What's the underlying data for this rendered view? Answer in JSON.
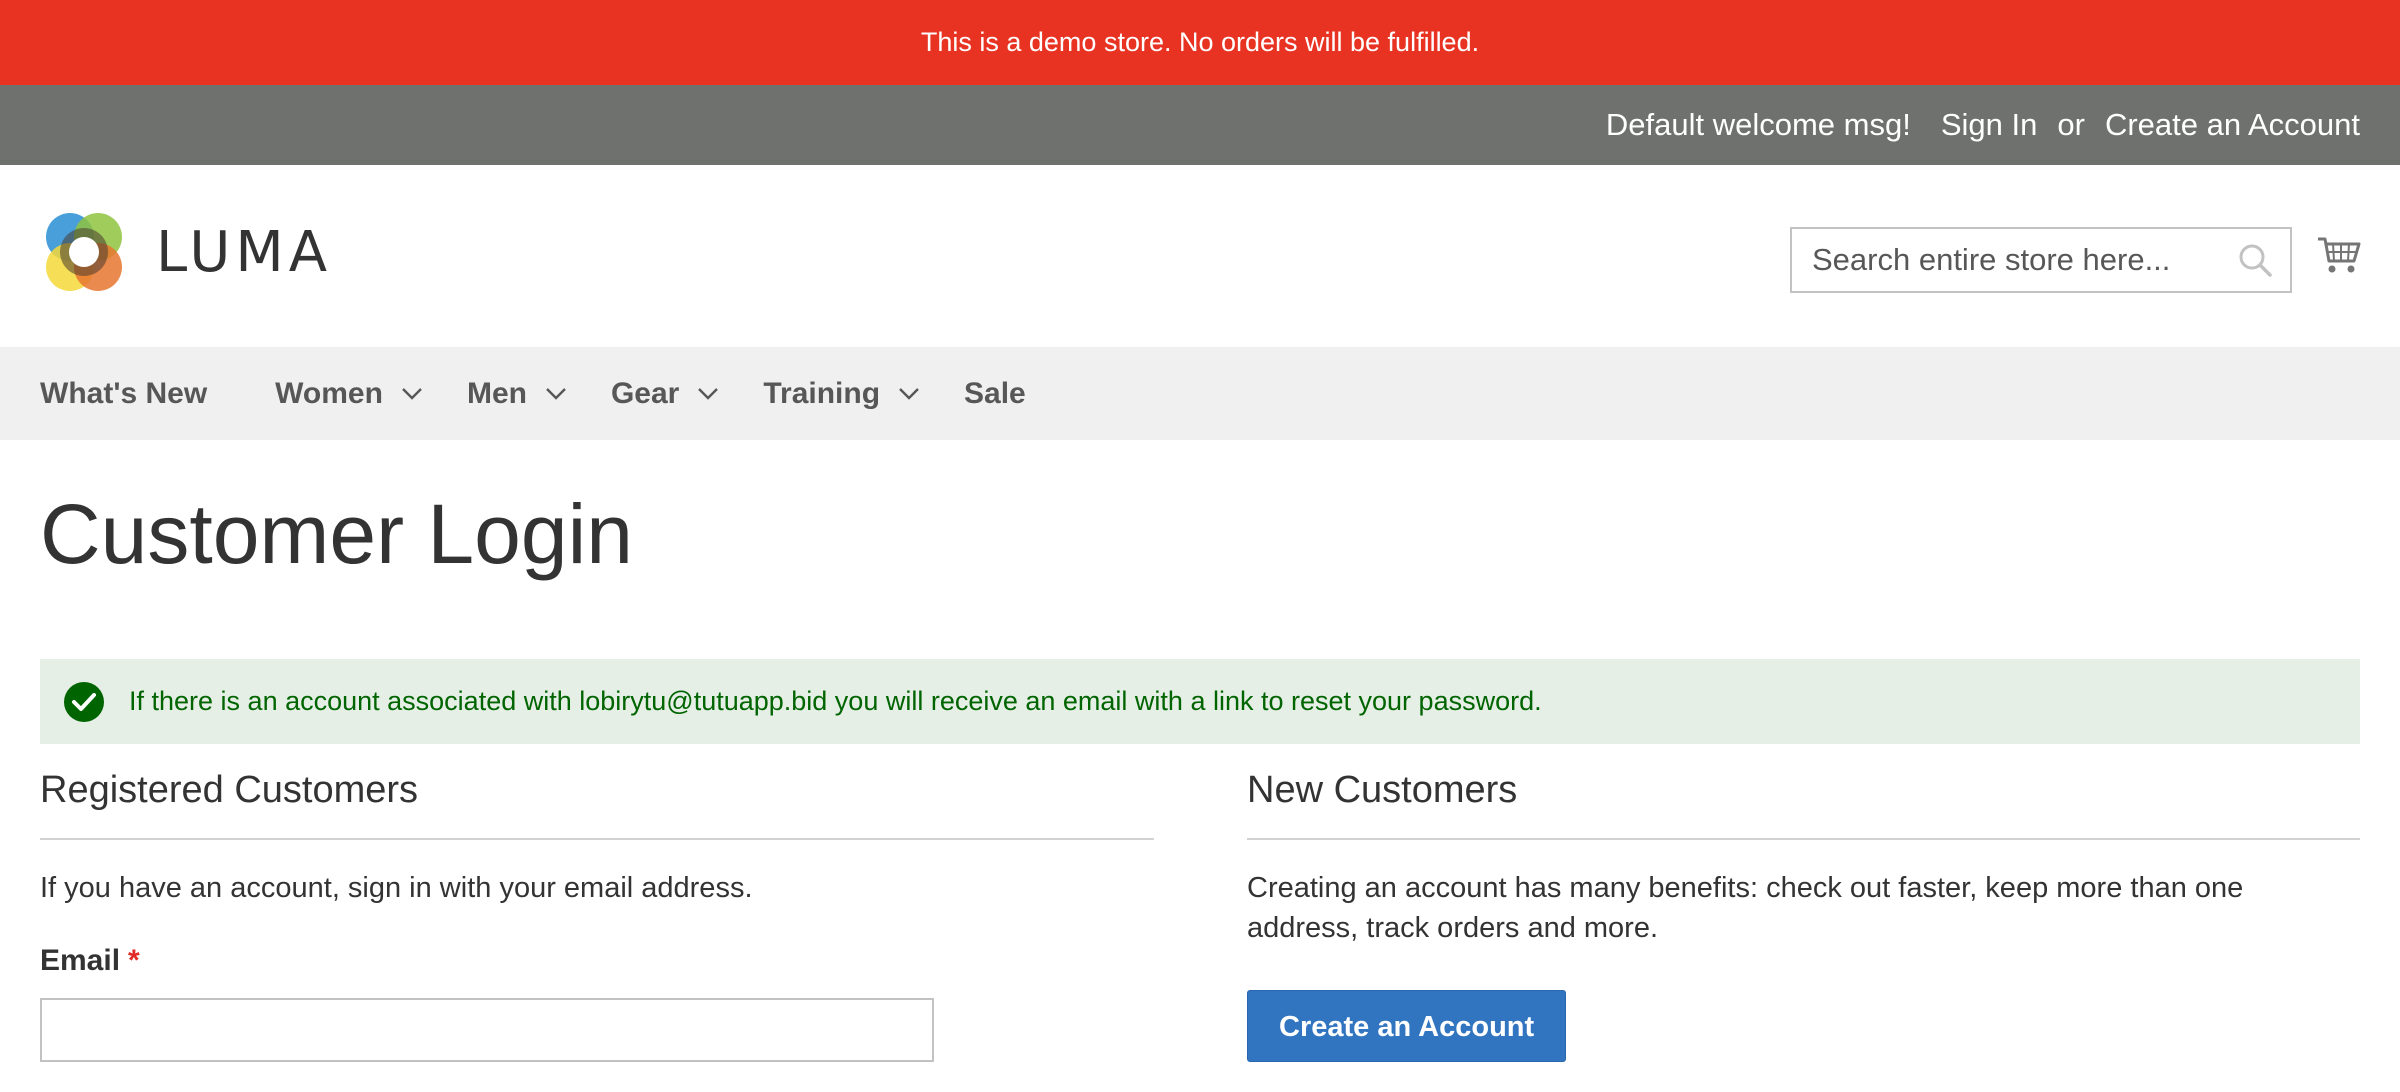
{
  "demo_banner": {
    "text": "This is a demo store. No orders will be fulfilled."
  },
  "top_links": {
    "welcome": "Default welcome msg!",
    "sign_in": "Sign In",
    "or": "or",
    "create_account": "Create an Account"
  },
  "header": {
    "logo_text": "LUMA",
    "search_placeholder": "Search entire store here...",
    "search_value": "",
    "icons": [
      "search-icon",
      "cart-icon"
    ]
  },
  "nav": {
    "items": [
      {
        "label": "What's New",
        "has_submenu": false
      },
      {
        "label": "Women",
        "has_submenu": true
      },
      {
        "label": "Men",
        "has_submenu": true
      },
      {
        "label": "Gear",
        "has_submenu": true
      },
      {
        "label": "Training",
        "has_submenu": true
      },
      {
        "label": "Sale",
        "has_submenu": false
      }
    ]
  },
  "page": {
    "title": "Customer Login"
  },
  "message": {
    "type": "success",
    "text": "If there is an account associated with lobirytu@tutuapp.bid you will receive an email with a link to reset your password."
  },
  "registered": {
    "title": "Registered Customers",
    "intro": "If you have an account, sign in with your email address.",
    "email_label": "Email",
    "required_mark": "*",
    "email_value": ""
  },
  "new_customers": {
    "title": "New Customers",
    "intro": "Creating an account has many benefits: check out faster, keep more than one address, track orders and more.",
    "button_label": "Create an Account"
  },
  "colors": {
    "demo_banner": "#e83323",
    "top_bar": "#6e716e",
    "nav_bg": "#f0f0f0",
    "success_bg": "#e5efe5",
    "success_text": "#006400",
    "primary_button": "#3174c0"
  }
}
